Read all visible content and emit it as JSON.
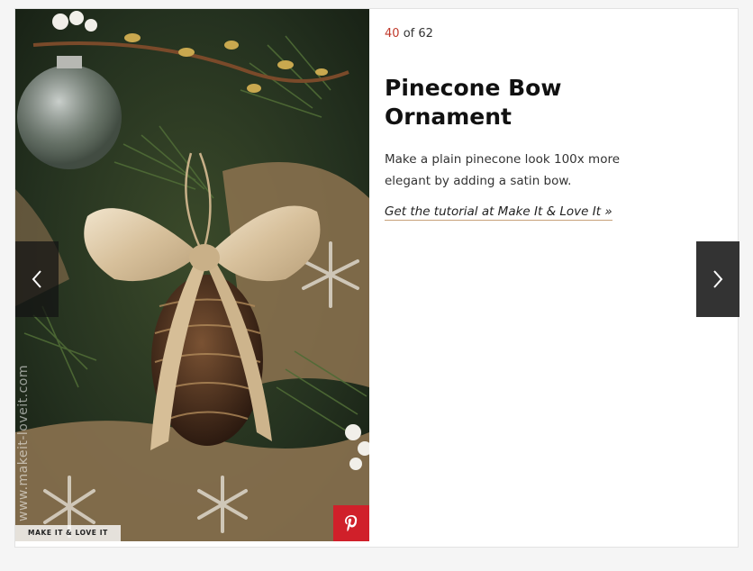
{
  "slide": {
    "counter": {
      "current": "40",
      "of_text": "of 62"
    },
    "title": "Pinecone Bow Ornament",
    "description": "Make a plain pinecone look 100x more elegant by adding a satin bow.",
    "link_text": "Get the tutorial at Make It & Love It »"
  },
  "photo": {
    "alt": "Pinecone ornament with a satin bow hanging on a Christmas tree",
    "watermark": "www.makeit-loveit.com",
    "credit": "MAKE IT & LOVE IT"
  },
  "controls": {
    "prev_icon": "chevron-left-icon",
    "next_icon": "chevron-right-icon",
    "pin_icon": "pinterest-icon"
  },
  "colors": {
    "accent": "#c0392b",
    "pinterest": "#d0202a",
    "nav_dark": "#333333",
    "link_underline": "#c7a17a"
  }
}
